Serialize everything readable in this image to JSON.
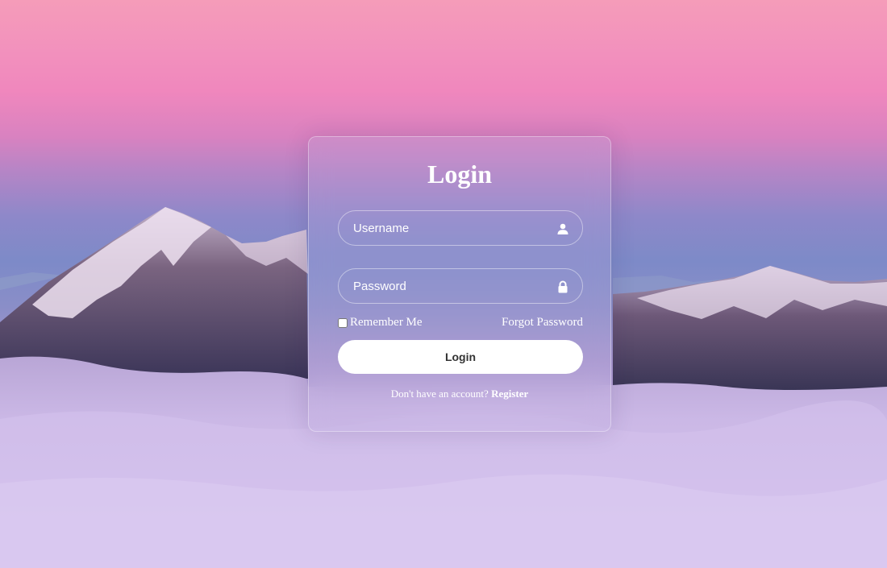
{
  "login_form": {
    "title": "Login",
    "username_placeholder": "Username",
    "password_placeholder": "Password",
    "remember_label": "Remember Me",
    "forgot_label": "Forgot Password",
    "submit_label": "Login",
    "register_prompt": "Don't have an account?",
    "register_label": "Register"
  },
  "icons": {
    "username": "user-icon",
    "password": "lock-icon"
  },
  "colors": {
    "text": "#ffffff",
    "button_bg": "#ffffff",
    "button_text": "#333333"
  }
}
